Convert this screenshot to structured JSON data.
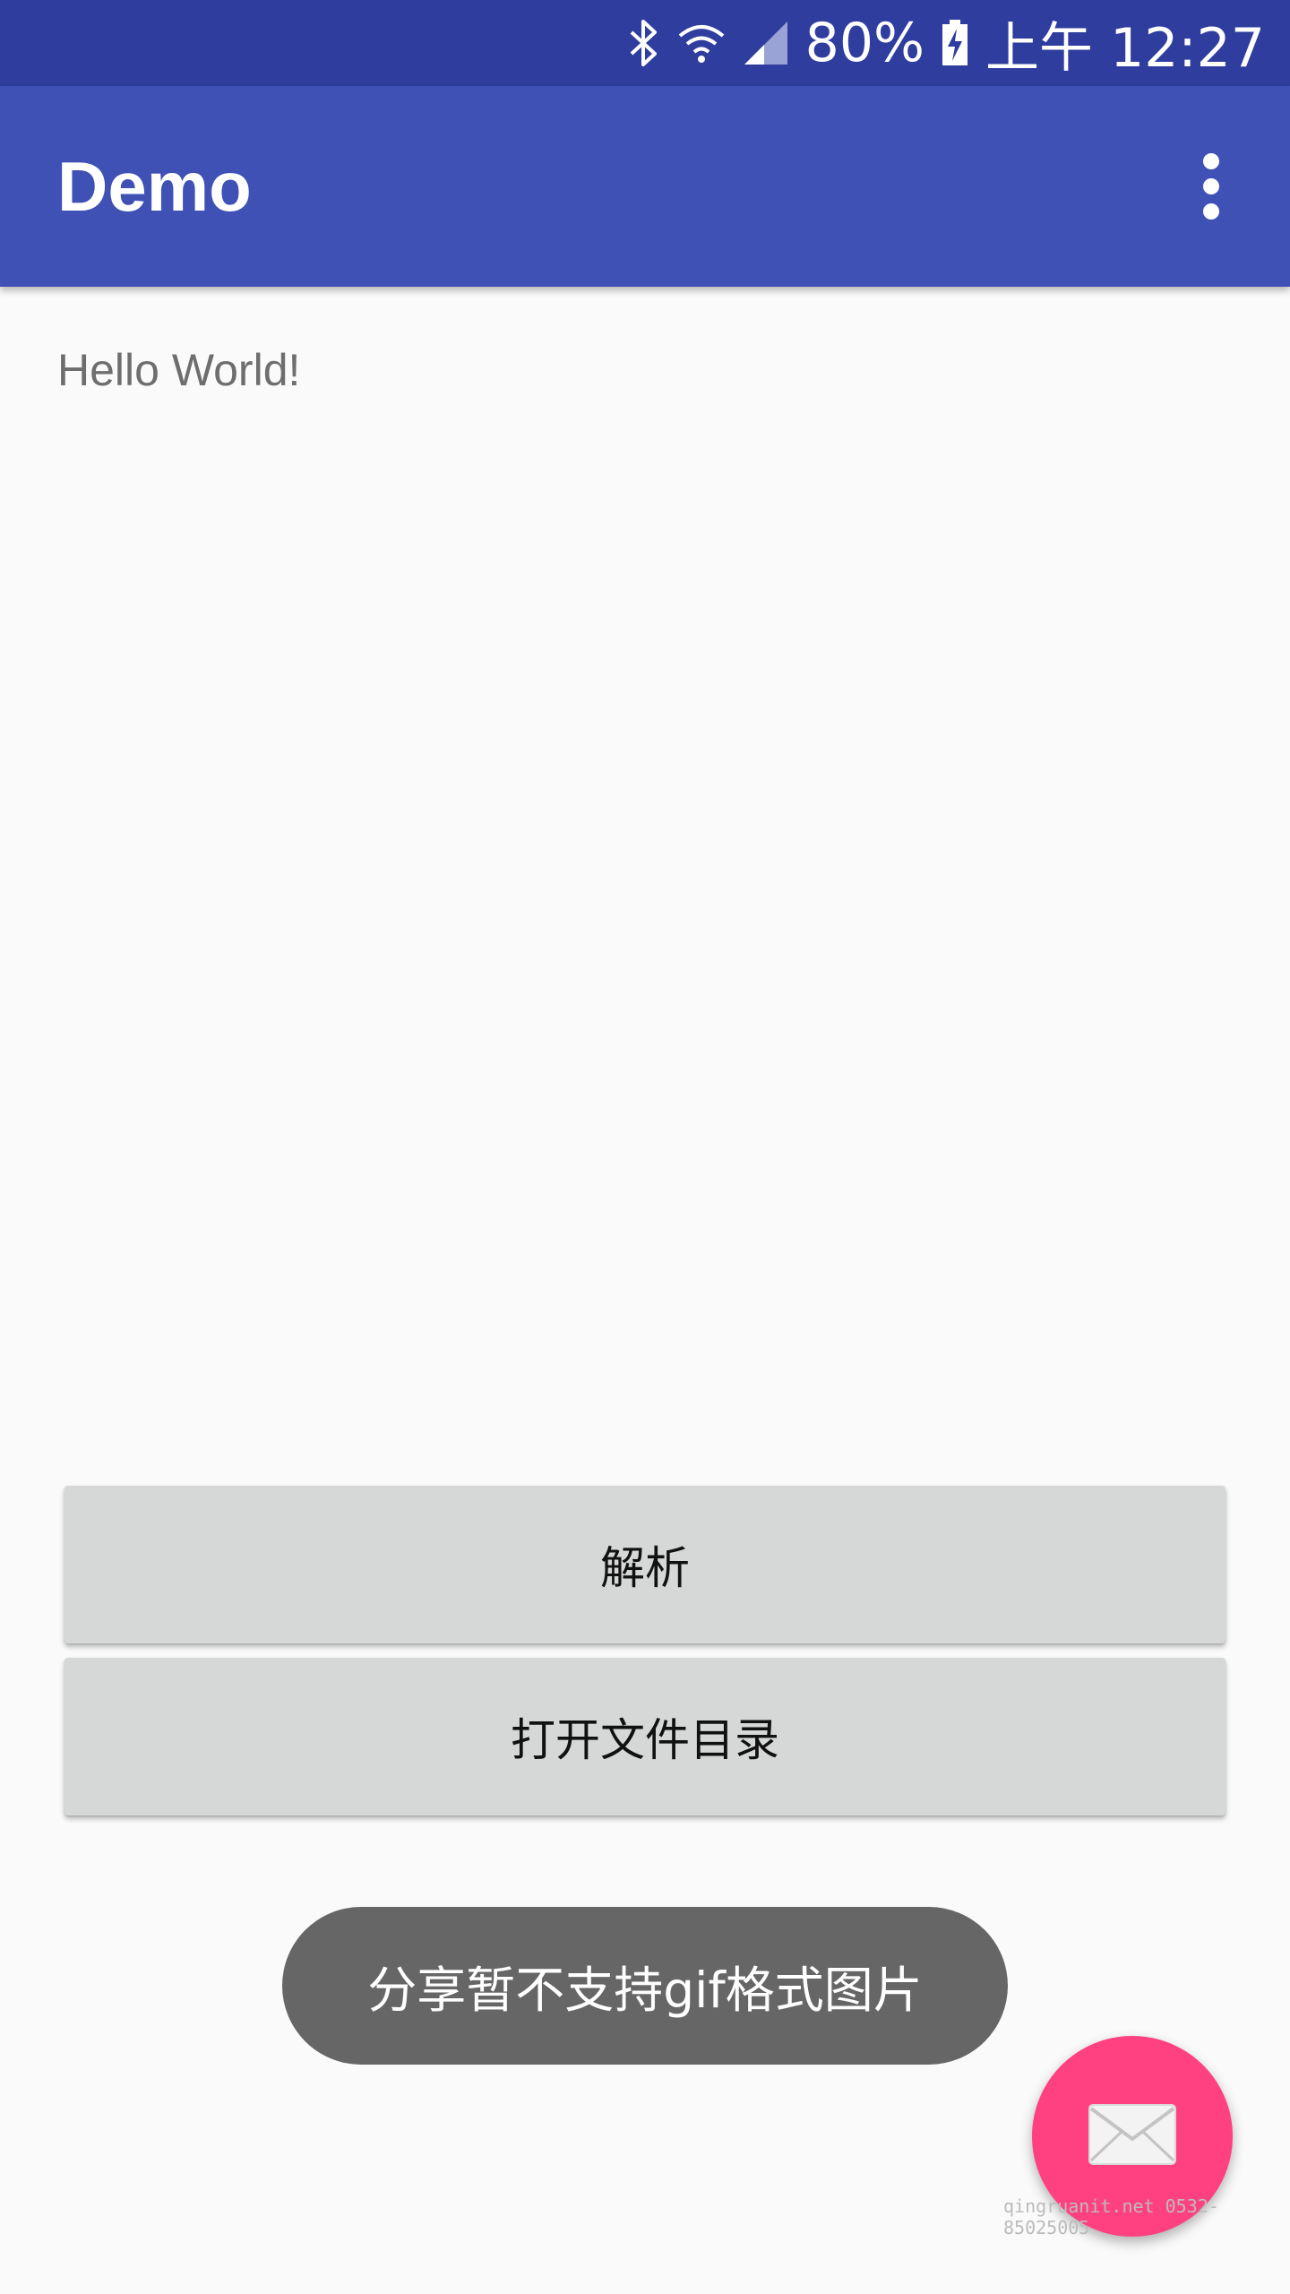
{
  "status_bar": {
    "battery": "80%",
    "time": "上午 12:27",
    "icons": [
      "bluetooth-icon",
      "wifi-icon",
      "cell-signal-icon",
      "battery-charging-icon"
    ]
  },
  "app_bar": {
    "title": "Demo",
    "overflow_icon": "more-vert-icon"
  },
  "content": {
    "hello_text": "Hello World!"
  },
  "buttons": {
    "parse_label": "解析",
    "open_dir_label": "打开文件目录"
  },
  "toast": {
    "message": "分享暂不支持gif格式图片"
  },
  "fab": {
    "icon": "mail-icon"
  },
  "watermark": {
    "text": "qingruanit.net 0532-85025005"
  },
  "colors": {
    "status_bar": "#2f3d9e",
    "primary": "#3f51b5",
    "accent": "#ff4081",
    "toast_bg": "#666666",
    "button_bg": "#d6d7d7"
  }
}
